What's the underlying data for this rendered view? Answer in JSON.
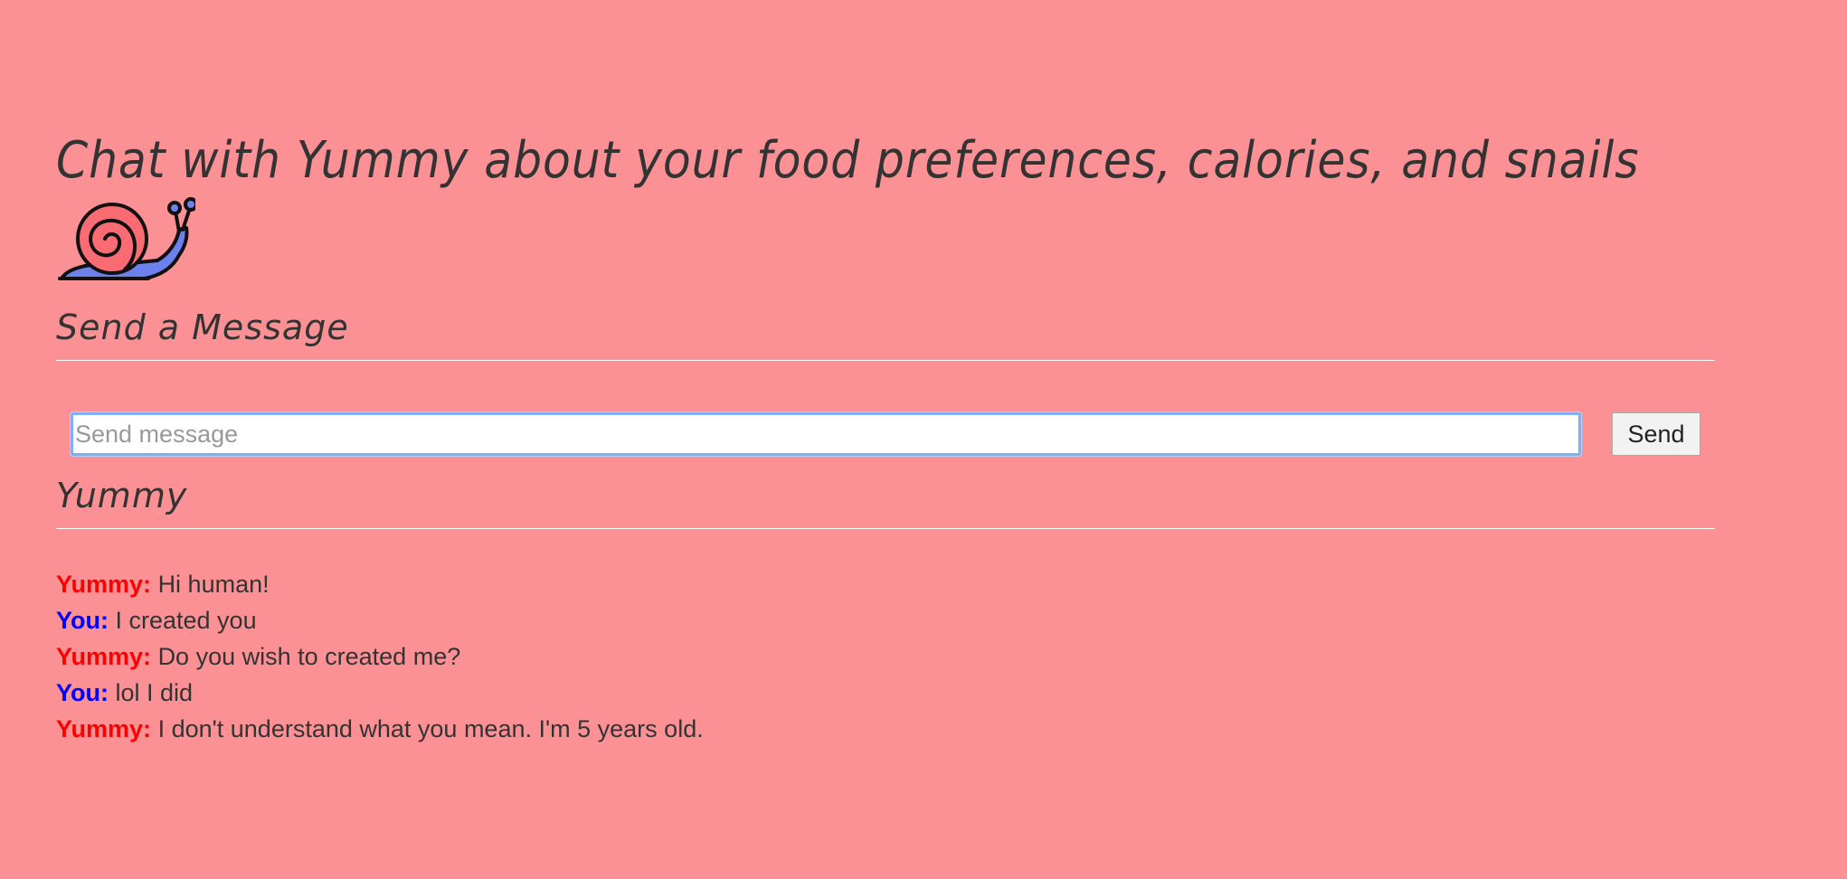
{
  "header": {
    "title": "Chat with Yummy about your food preferences, calories, and snails"
  },
  "logo": {
    "icon": "snail-icon",
    "shell_color": "#fb6b74",
    "body_color": "#6d80ec"
  },
  "send_section": {
    "heading": "Send a Message",
    "input": {
      "value": "",
      "placeholder": "Send message"
    },
    "send_label": "Send"
  },
  "chat_section": {
    "heading": "Yummy",
    "speaker_colors": {
      "Yummy": "#ff0000",
      "You": "#0000ff"
    },
    "messages": [
      {
        "speaker": "Yummy:",
        "text": "Hi human!"
      },
      {
        "speaker": "You:",
        "text": "I created you"
      },
      {
        "speaker": "Yummy:",
        "text": "Do you wish to created me?"
      },
      {
        "speaker": "You:",
        "text": "lol I did"
      },
      {
        "speaker": "Yummy:",
        "text": "I don't understand what you mean. I'm 5 years old."
      }
    ]
  },
  "colors": {
    "background": "#fb9195",
    "text": "#333333",
    "divider": "#ffffff",
    "input_focus": "#7eaef3"
  }
}
